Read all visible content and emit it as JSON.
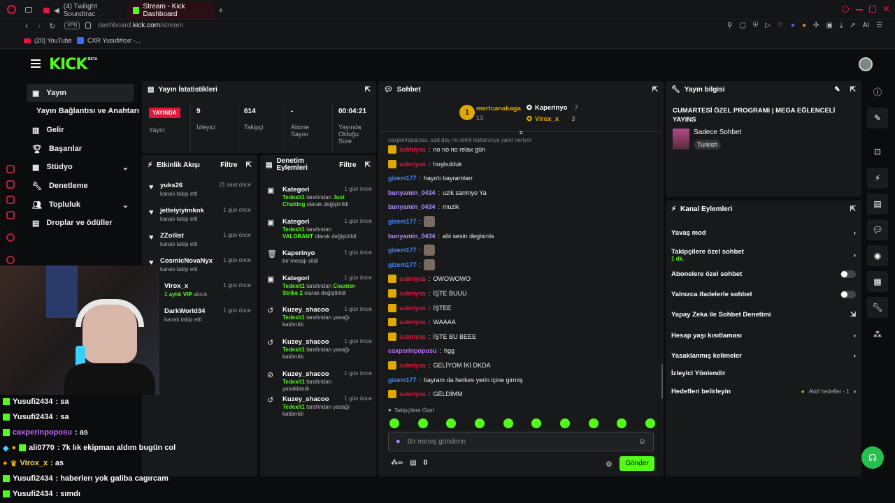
{
  "browser": {
    "tabs": [
      {
        "label": "(4) Twilight Soundtrac"
      },
      {
        "label": "Stream - Kick Dashboard"
      }
    ],
    "url_host": "dashboard.",
    "url_domain": "kick.com",
    "url_path": "/stream",
    "vpn": "VPN",
    "bookmarks": [
      {
        "label": "(20) YouTube"
      },
      {
        "label": "CXR Yusufi#cxr -..."
      }
    ],
    "ai_label": "AI"
  },
  "brand": {
    "logo": "KICK",
    "beta": "BETA",
    "accent": "#53fc18"
  },
  "nav": {
    "items": [
      {
        "label": "Yayın"
      },
      {
        "label": "Yayın Bağlantısı ve Anahtarı"
      },
      {
        "label": "Gelir"
      },
      {
        "label": "Başarılar"
      },
      {
        "label": "Stüdyo"
      },
      {
        "label": "Denetleme"
      },
      {
        "label": "Topluluk"
      },
      {
        "label": "Droplar ve ödüller"
      }
    ]
  },
  "stats": {
    "title": "Yayın İstatistikleri",
    "live": "YAYINDA",
    "live_label": "Yayın",
    "viewers": "9",
    "viewers_label": "İzleyici",
    "followers": "614",
    "followers_label": "Takipçi",
    "subs": "-",
    "subs_label": "Abone Sayısı",
    "duration": "00:04:21",
    "duration_label": "Yayında Olduğu Süre"
  },
  "activity": {
    "title": "Etkinlik Akışı",
    "filter": "Filtre",
    "items": [
      {
        "user": "yuks26",
        "desc": "kanalı takip etti",
        "time": "21 saat önce"
      },
      {
        "user": "jetteiyiyimknk",
        "desc": "kanalı takip etti",
        "time": "1 gün önce"
      },
      {
        "user": "ZZoilist",
        "desc": "kanalı takip etti",
        "time": "1 gün önce"
      },
      {
        "user": "CosmicNovaNyx",
        "desc": "kanalı takip etti",
        "time": "1 gün önce"
      },
      {
        "user": "Virox_x",
        "desc_a": "1 aylık VIP",
        "desc_b": " alındı",
        "time": "1 gün önce"
      },
      {
        "user": "DarkWorld34",
        "desc": "kanalı takip etti",
        "time": "1 gün önce"
      }
    ]
  },
  "modlog": {
    "title": "Denetim Eylemleri",
    "filter": "Filtre",
    "items": [
      {
        "user": "Kategori",
        "time": "1 gün önce",
        "a": "Tedexit1",
        "b": " tarafından ",
        "c": "Just Chatting",
        "d": " olarak değiştirildi"
      },
      {
        "user": "Kategori",
        "time": "1 gün önce",
        "a": "Tedexit1",
        "b": " tarafından ",
        "c": "VALORANT",
        "d": " olarak değiştirildi"
      },
      {
        "user": "Kaperinyo",
        "time": "1 gün önce",
        "a": "",
        "b": "bir mesajı sildi",
        "c": "",
        "d": ""
      },
      {
        "user": "Kategori",
        "time": "1 gün önce",
        "a": "Tedexit1",
        "b": " tarafından ",
        "c": "Counter-Strike 2",
        "d": " olarak değiştirildi"
      },
      {
        "user": "Kuzey_shacoo",
        "time": "1 gün önce",
        "a": "Tedexit1",
        "b": " tarafından yasağı kaldırıldı",
        "c": "",
        "d": ""
      },
      {
        "user": "Kuzey_shacoo",
        "time": "1 gün önce",
        "a": "Tedexit1",
        "b": " tarafından yasağı kaldırıldı",
        "c": "",
        "d": ""
      },
      {
        "user": "Kuzey_shacoo",
        "time": "1 gün önce",
        "a": "Tedexit1",
        "b": " tarafından yasaklandı",
        "c": "",
        "d": ""
      },
      {
        "user": "Kuzey_shacoo",
        "time": "1 gün önce",
        "a": "Tedexit1",
        "b": " tarafından yasağı kaldırıldı",
        "c": "",
        "d": ""
      }
    ]
  },
  "chat": {
    "title": "Sohbet",
    "top": [
      {
        "rank": "1",
        "user": "mertcanakaga",
        "count": "13"
      },
      {
        "user": "Kaperinyo",
        "count": "7"
      },
      {
        "user": "Virox_x",
        "count": "3"
      }
    ],
    "reply": "caxperinpoposu: sad day mi isimli kullanıcıya yanıt veriyor",
    "messages": [
      {
        "user": "salmiyas",
        "text": "no no no relax gün",
        "color": "#e3163a",
        "crown": true
      },
      {
        "user": "salmiyas",
        "text": "hoşbulduk",
        "color": "#e3163a",
        "crown": true
      },
      {
        "user": "gizem177",
        "text": "hayırlı bayramlarr",
        "color": "#3d8bff"
      },
      {
        "user": "bunyamin_0434",
        "text": "uzik sarmiyo Ya",
        "color": "#b48cff"
      },
      {
        "user": "bunyamin_0434",
        "text": "muzik",
        "color": "#b48cff"
      },
      {
        "user": "gizem177",
        "text": "",
        "color": "#3d8bff",
        "emote": true
      },
      {
        "user": "bunyamin_0434",
        "text": "abi sesin degismis",
        "color": "#b48cff"
      },
      {
        "user": "gizem177",
        "text": "",
        "color": "#3d8bff",
        "emote": true
      },
      {
        "user": "gizem177",
        "text": "",
        "color": "#3d8bff",
        "emote": true
      },
      {
        "user": "salmiyas",
        "text": "OWOWOWO",
        "color": "#e3163a",
        "crown": true
      },
      {
        "user": "salmiyas",
        "text": "İŞTE BUUU",
        "color": "#e3163a",
        "crown": true
      },
      {
        "user": "salmiyas",
        "text": "İŞTEE",
        "color": "#e3163a",
        "crown": true
      },
      {
        "user": "salmiyas",
        "text": "WAAAA",
        "color": "#e3163a",
        "crown": true
      },
      {
        "user": "salmiyas",
        "text": "İŞTE BU BEEE",
        "color": "#e3163a",
        "crown": true
      },
      {
        "user": "caxperinpoposu",
        "text": "hgg",
        "color": "#c06cff"
      },
      {
        "user": "salmiyas",
        "text": "GELİYOM İKİ DKDA",
        "color": "#e3163a",
        "crown": true
      },
      {
        "user": "gizem177",
        "text": "bayram da herkes yerin içine girmiş",
        "color": "#3d8bff"
      },
      {
        "user": "salmiyas",
        "text": "GELDİMM",
        "color": "#e3163a",
        "crown": true
      }
    ],
    "followers_only": "Takipçilere Özel",
    "placeholder": "Bir mesaj gönderin",
    "points": "0",
    "send": "Gönder"
  },
  "info": {
    "title": "Yayın bilgisi",
    "stream_title": "CUMARTESİ ÖZEL PROGRAMI | MEGA EĞLENCELİ YAYINS",
    "category": "Sadece Sohbet",
    "tag": "Turkish"
  },
  "channel": {
    "title": "Kanal Eylemleri",
    "actions": [
      {
        "label": "Yavaş mod"
      },
      {
        "label": "Takipçilere özel sohbet",
        "sub": "1 dk."
      },
      {
        "label": "Abonelere özel sohbet"
      },
      {
        "label": "Yalnızca ifadelerle sohbet"
      },
      {
        "label": "Yapay Zeka ile Sohbet Denetimi"
      },
      {
        "label": "Hesap yaşı kısıtlaması"
      },
      {
        "label": "Yasaklanmış kelimeler"
      },
      {
        "label": "İzleyici Yönlendir"
      },
      {
        "label": "Hedefleri belirleyin",
        "sub": "Aktif hedefler - 1"
      }
    ]
  },
  "overlay": {
    "lines": [
      {
        "user": "Yusufi2434",
        "text": " : sa",
        "color": "#ffffff"
      },
      {
        "user": "Yusufi2434",
        "text": " : sa",
        "color": "#ffffff"
      },
      {
        "user": "caxperinpoposu",
        "text": " : as",
        "color": "#c06cff"
      },
      {
        "user": "ali0770",
        "text": " : 7k lık ekipman aldım bugün col",
        "color": "#ffffff"
      },
      {
        "user": "Virox_x",
        "text": " : as",
        "color": "#ffd84a"
      },
      {
        "user": "Yusufi2434",
        "text": " : haberlerı yok galiba cagırcam",
        "color": "#ffffff"
      },
      {
        "user": "Yusufi2434",
        "text": " : sımdı",
        "color": "#ffffff"
      }
    ]
  }
}
